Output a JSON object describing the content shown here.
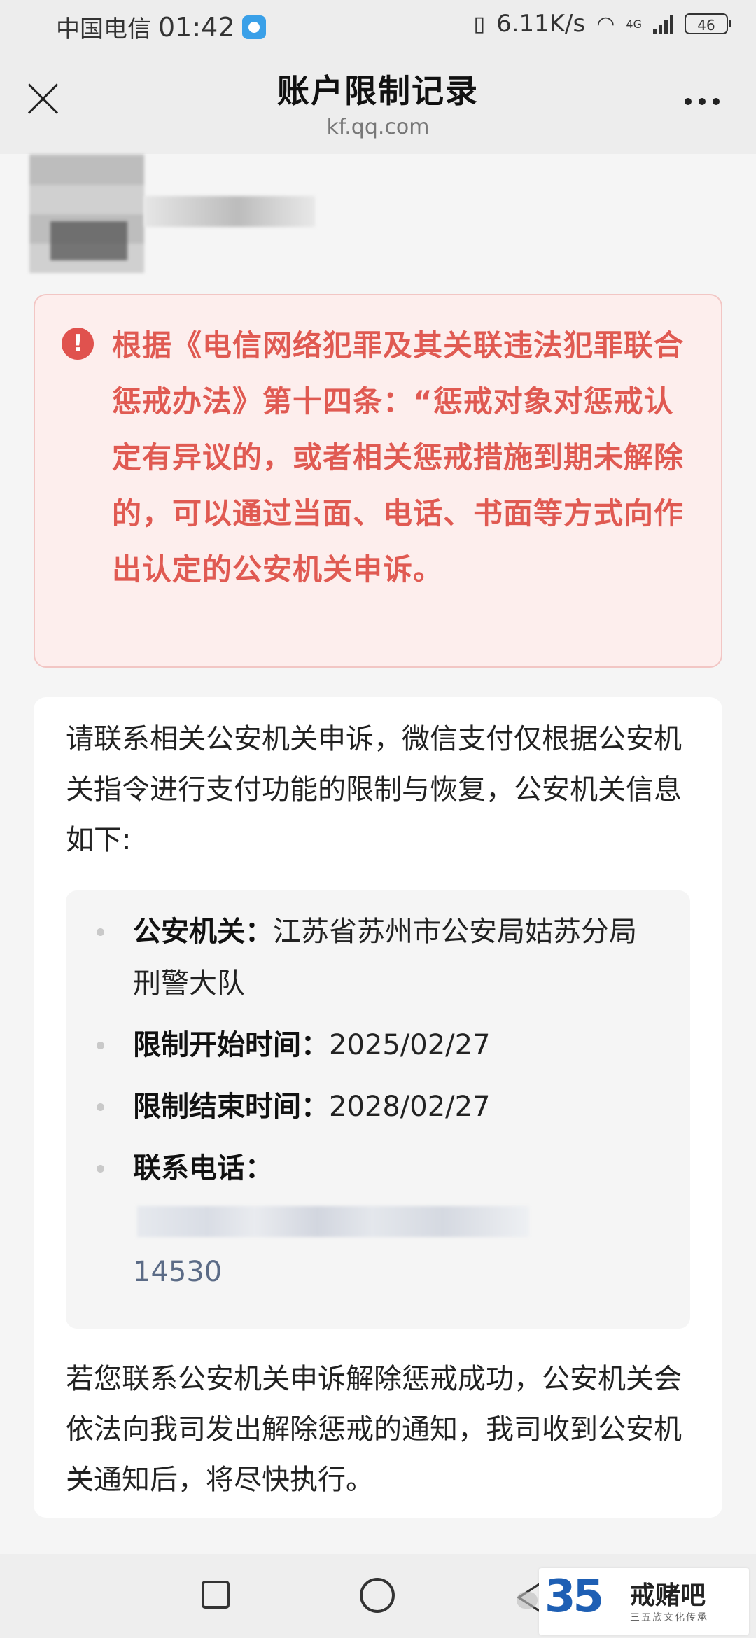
{
  "status_bar": {
    "carrier": "中国电信",
    "time": "01:42",
    "net_speed": "6.11K/s",
    "network_type": "4G",
    "battery": "46",
    "icons": [
      "message-app-icon",
      "vibrate-icon",
      "wifi-icon",
      "signal-icon",
      "battery-icon"
    ]
  },
  "nav": {
    "title": "账户限制记录",
    "domain": "kf.qq.com",
    "close_icon": "close-icon",
    "more_icon": "more-icon"
  },
  "warning": {
    "icon": "alert-icon",
    "icon_glyph": "!",
    "text": "根据《电信网络犯罪及其关联违法犯罪联合惩戒办法》第十四条：“惩戒对象对惩戒认定有异议的，或者相关惩戒措施到期未解除的，可以通过当面、电话、书面等方式向作出认定的公安机关申诉。",
    "color": "#e05a52"
  },
  "info": {
    "intro": "请联系相关公安机关申诉，微信支付仅根据公安机关指令进行支付功能的限制与恢复，公安机关信息如下:",
    "details": [
      {
        "label": "公安机关：",
        "value": "江苏省苏州市公安局姑苏分局刑警大队"
      },
      {
        "label": "限制开始时间：",
        "value": "2025/02/27"
      },
      {
        "label": "限制结束时间：",
        "value": "2028/02/27"
      },
      {
        "label": "联系电话：",
        "value": "14530"
      }
    ],
    "outro": "若您联系公安机关申诉解除惩戒成功，公安机关会依法向我司发出解除惩戒的通知，我司收到公安机关通知后，将尽快执行。"
  },
  "bottom_nav": {
    "icons": [
      "recent-apps-icon",
      "home-icon",
      "back-icon"
    ]
  },
  "watermark": {
    "logo_text": "35",
    "name": "戒赌吧",
    "subtitle": "三五族文化传承"
  }
}
